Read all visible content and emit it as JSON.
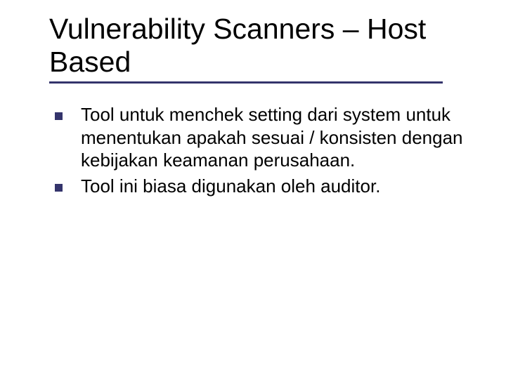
{
  "title": "Vulnerability Scanners – Host Based",
  "bullets": [
    "Tool untuk menchek setting dari system untuk menentukan apakah sesuai / konsisten dengan kebijakan keamanan perusahaan.",
    "Tool ini biasa digunakan oleh auditor."
  ]
}
